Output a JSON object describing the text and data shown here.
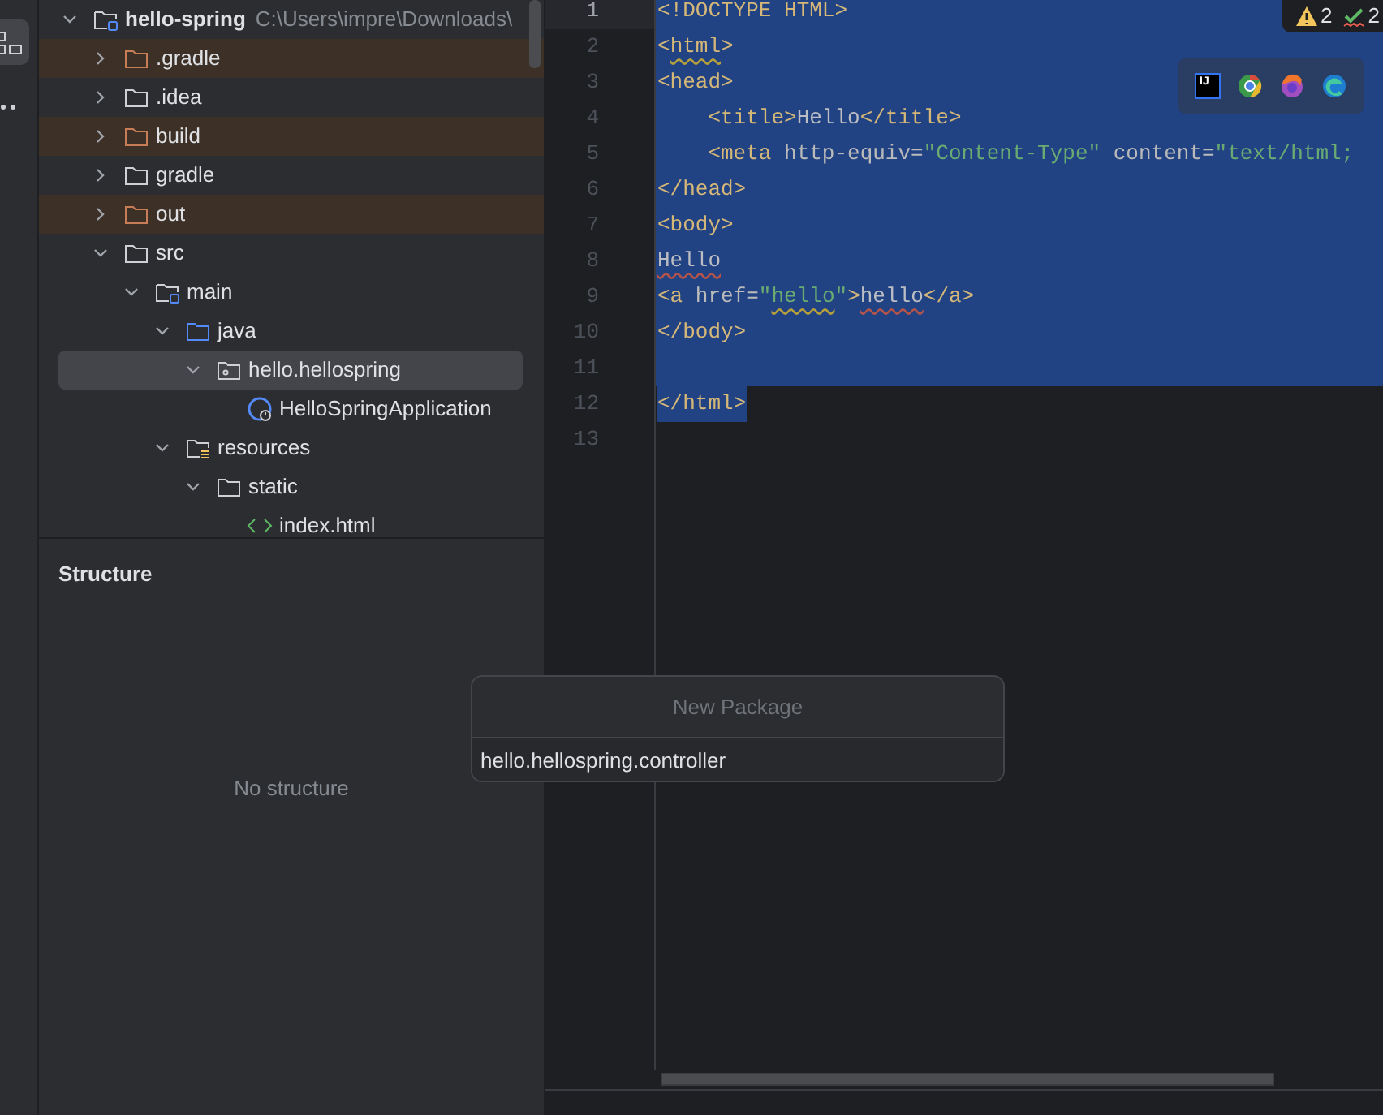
{
  "tool_strip": {
    "items": [
      {
        "kind": "structure",
        "selected": true
      },
      {
        "kind": "more",
        "selected": false
      }
    ]
  },
  "project_tree": {
    "items": [
      {
        "label": "hello-spring",
        "path": "C:\\Users\\impre\\Downloads\\",
        "kind": "module",
        "expanded": true,
        "selected": false,
        "excluded": false,
        "children": [
          {
            "label": ".gradle",
            "kind": "folder",
            "expanded": false,
            "selected": false,
            "excluded": true
          },
          {
            "label": ".idea",
            "kind": "folder",
            "expanded": false,
            "selected": false,
            "excluded": false
          },
          {
            "label": "build",
            "kind": "folder",
            "expanded": false,
            "selected": false,
            "excluded": true
          },
          {
            "label": "gradle",
            "kind": "folder",
            "expanded": false,
            "selected": false,
            "excluded": false
          },
          {
            "label": "out",
            "kind": "folder",
            "expanded": false,
            "selected": false,
            "excluded": true
          },
          {
            "label": "src",
            "kind": "folder",
            "expanded": true,
            "selected": false,
            "excluded": false,
            "children": [
              {
                "label": "main",
                "kind": "module-folder",
                "expanded": true,
                "selected": false,
                "excluded": false,
                "children": [
                  {
                    "label": "java",
                    "kind": "source",
                    "expanded": true,
                    "selected": false,
                    "excluded": false,
                    "children": [
                      {
                        "label": "hello.hellospring",
                        "kind": "package",
                        "expanded": true,
                        "selected": true,
                        "excluded": false,
                        "children": [
                          {
                            "label": "HelloSpringApplication",
                            "kind": "class",
                            "selected": false,
                            "excluded": false
                          }
                        ]
                      }
                    ]
                  },
                  {
                    "label": "resources",
                    "kind": "resources",
                    "expanded": true,
                    "selected": false,
                    "excluded": false,
                    "children": [
                      {
                        "label": "static",
                        "kind": "folder",
                        "expanded": true,
                        "selected": false,
                        "excluded": false,
                        "children": [
                          {
                            "label": "index.html",
                            "kind": "html",
                            "selected": false,
                            "excluded": false
                          }
                        ]
                      }
                    ]
                  }
                ]
              }
            ]
          }
        ]
      }
    ]
  },
  "structure": {
    "title": "Structure",
    "empty_text": "No structure"
  },
  "editor": {
    "lines": [
      {
        "number": "1",
        "current": true,
        "selected": true,
        "segments": [
          {
            "text": "<!DOCTYPE HTML>",
            "kind": "tag"
          }
        ]
      },
      {
        "number": "2",
        "current": false,
        "selected": true,
        "segments": [
          {
            "text": "<",
            "kind": "tag"
          },
          {
            "text": "html",
            "kind": "tag",
            "warning": true
          },
          {
            "text": ">",
            "kind": "tag"
          }
        ]
      },
      {
        "number": "3",
        "current": false,
        "selected": true,
        "segments": [
          {
            "text": "<head>",
            "kind": "tag"
          }
        ]
      },
      {
        "number": "4",
        "current": false,
        "selected": true,
        "segments": [
          {
            "text": "    <title>",
            "kind": "tag"
          },
          {
            "text": "Hello",
            "kind": "text"
          },
          {
            "text": "</title>",
            "kind": "tag"
          }
        ]
      },
      {
        "number": "5",
        "current": false,
        "selected": true,
        "segments": [
          {
            "text": "    <meta",
            "kind": "tag"
          },
          {
            "text": " http-equiv=",
            "kind": "attr"
          },
          {
            "text": "\"Content-Type\"",
            "kind": "string"
          },
          {
            "text": " content=",
            "kind": "attr"
          },
          {
            "text": "\"text/html;",
            "kind": "string"
          }
        ]
      },
      {
        "number": "6",
        "current": false,
        "selected": true,
        "segments": [
          {
            "text": "</head>",
            "kind": "tag"
          }
        ]
      },
      {
        "number": "7",
        "current": false,
        "selected": true,
        "segments": [
          {
            "text": "<body>",
            "kind": "tag"
          }
        ]
      },
      {
        "number": "8",
        "current": false,
        "selected": true,
        "segments": [
          {
            "text": "Hello",
            "kind": "text",
            "typo": true
          }
        ]
      },
      {
        "number": "9",
        "current": false,
        "selected": true,
        "segments": [
          {
            "text": "<a",
            "kind": "tag"
          },
          {
            "text": " href=",
            "kind": "attr"
          },
          {
            "text": "\"",
            "kind": "string"
          },
          {
            "text": "hello",
            "kind": "string",
            "warning": true
          },
          {
            "text": "\"",
            "kind": "string"
          },
          {
            "text": ">",
            "kind": "tag"
          },
          {
            "text": "hello",
            "kind": "text",
            "typo": true
          },
          {
            "text": "</a>",
            "kind": "tag"
          }
        ]
      },
      {
        "number": "10",
        "current": false,
        "selected": true,
        "segments": [
          {
            "text": "</body>",
            "kind": "tag"
          }
        ]
      },
      {
        "number": "11",
        "current": false,
        "selected": true
      },
      {
        "number": "12",
        "current": false,
        "selected": true,
        "segments": [
          {
            "text": "</html>",
            "kind": "tag"
          }
        ]
      },
      {
        "number": "13",
        "current": false,
        "selected": false
      }
    ],
    "inspections": [
      {
        "kind": "warning",
        "count": "2"
      },
      {
        "kind": "typo",
        "count": "2"
      }
    ],
    "browsers": [
      {
        "kind": "intellij",
        "label": "IJ"
      },
      {
        "kind": "chrome"
      },
      {
        "kind": "firefox"
      },
      {
        "kind": "edge"
      }
    ]
  },
  "new_package_popup": {
    "title": "New Package",
    "value": "hello.hellospring.controller"
  }
}
